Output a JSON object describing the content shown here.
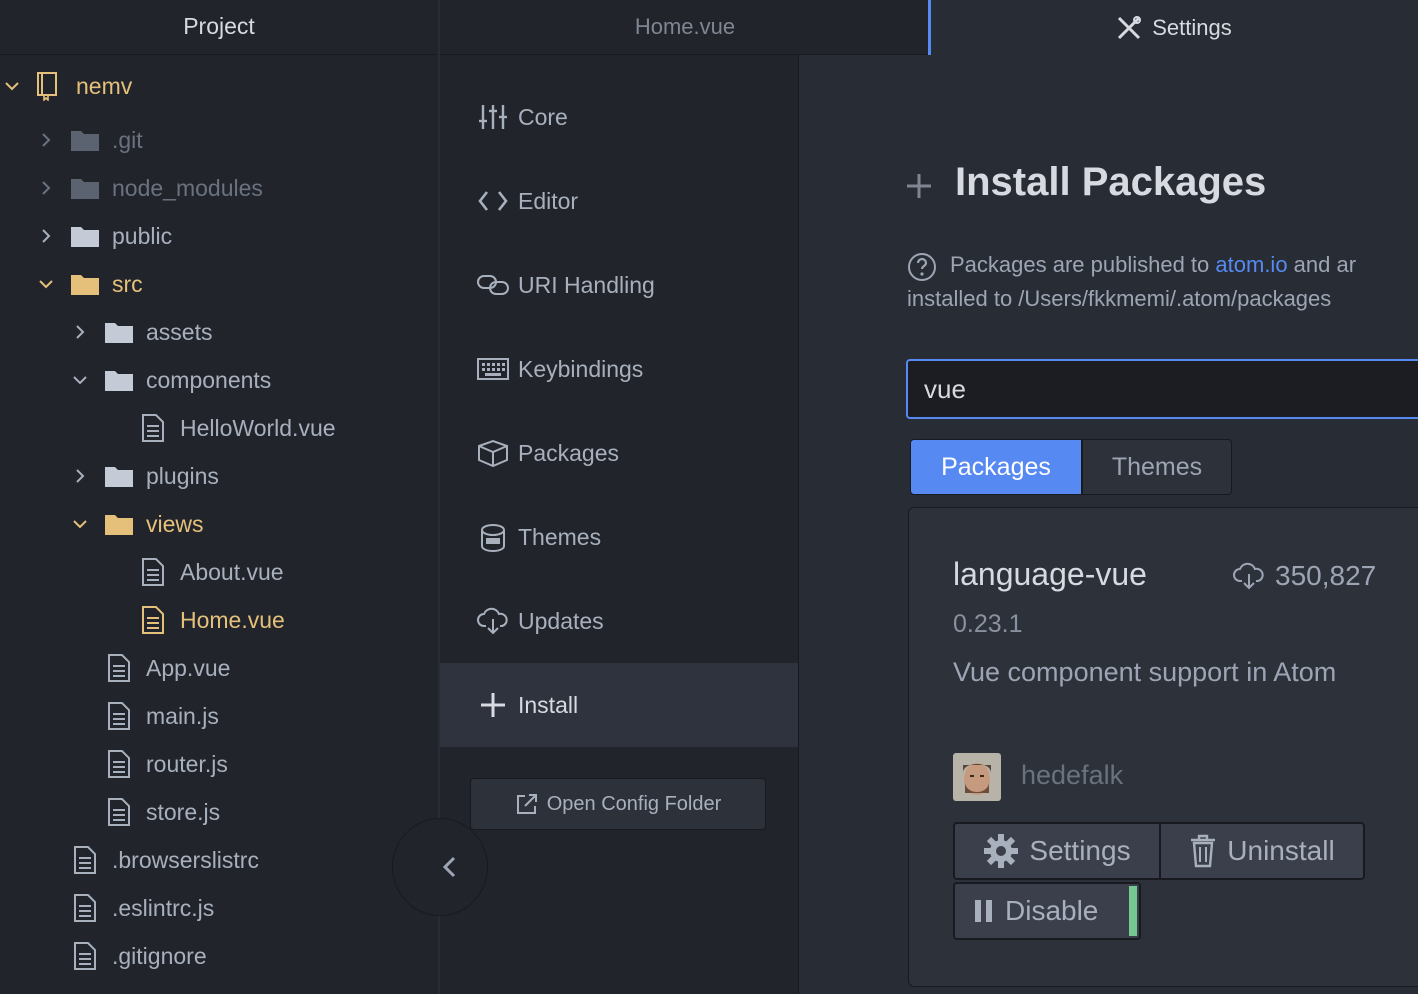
{
  "project_panel": {
    "header": "Project",
    "root": "nemv",
    "entries": [
      {
        "label": ".git",
        "type": "folder"
      },
      {
        "label": "node_modules",
        "type": "folder"
      },
      {
        "label": "public",
        "type": "folder"
      },
      {
        "label": "src",
        "type": "folder"
      },
      {
        "label": "assets",
        "type": "folder"
      },
      {
        "label": "components",
        "type": "folder"
      },
      {
        "label": "HelloWorld.vue",
        "type": "file"
      },
      {
        "label": "plugins",
        "type": "folder"
      },
      {
        "label": "views",
        "type": "folder"
      },
      {
        "label": "About.vue",
        "type": "file"
      },
      {
        "label": "Home.vue",
        "type": "file"
      },
      {
        "label": "App.vue",
        "type": "file"
      },
      {
        "label": "main.js",
        "type": "file"
      },
      {
        "label": "router.js",
        "type": "file"
      },
      {
        "label": "store.js",
        "type": "file"
      },
      {
        "label": ".browserslistrc",
        "type": "file"
      },
      {
        "label": ".eslintrc.js",
        "type": "file"
      },
      {
        "label": ".gitignore",
        "type": "file"
      }
    ]
  },
  "tabs": {
    "home": "Home.vue",
    "settings": "Settings"
  },
  "settings_nav": {
    "items": [
      {
        "label": "Core",
        "icon": "sliders-icon"
      },
      {
        "label": "Editor",
        "icon": "code-icon"
      },
      {
        "label": "URI Handling",
        "icon": "link-icon"
      },
      {
        "label": "Keybindings",
        "icon": "keyboard-icon"
      },
      {
        "label": "Packages",
        "icon": "package-icon"
      },
      {
        "label": "Themes",
        "icon": "paintcan-icon"
      },
      {
        "label": "Updates",
        "icon": "cloud-download-icon"
      },
      {
        "label": "Install",
        "icon": "plus-icon"
      }
    ],
    "active": "Install",
    "open_config": "Open Config Folder"
  },
  "install": {
    "title": "Install Packages",
    "info_prefix": "Packages are published to ",
    "info_link": "atom.io",
    "info_suffix": " and ar",
    "info_line2": "installed to /Users/fkkmemi/.atom/packages",
    "search_value": "vue",
    "toggle_packages": "Packages",
    "toggle_themes": "Themes"
  },
  "package": {
    "name": "language-vue",
    "downloads": "350,827",
    "version": "0.23.1",
    "description": "Vue component support in Atom",
    "author": "hedefalk",
    "buttons": {
      "settings": "Settings",
      "uninstall": "Uninstall",
      "disable": "Disable"
    }
  },
  "colors": {
    "accent": "#568af2",
    "highlight": "#e5c07b",
    "enabled_indicator": "#73c990"
  }
}
